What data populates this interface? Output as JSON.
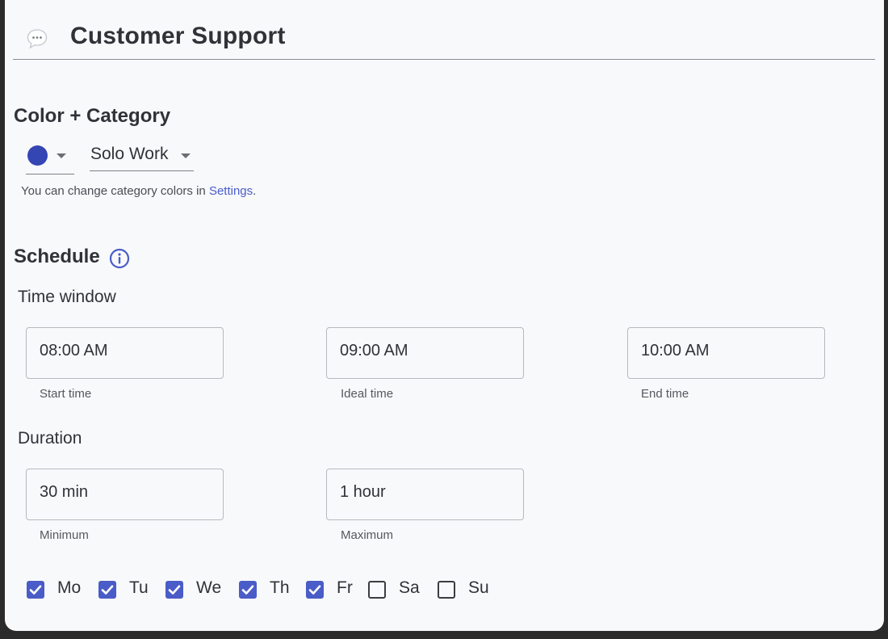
{
  "header": {
    "title": "Customer Support",
    "icon": "speech-bubble-icon"
  },
  "color_category": {
    "section_title": "Color + Category",
    "selected_color": "#3445b4",
    "category_value": "Solo Work",
    "hint_text": "You can change category colors in ",
    "hint_link": "Settings",
    "hint_end": "."
  },
  "schedule": {
    "section_title": "Schedule",
    "time_window": {
      "label": "Time window",
      "start": {
        "value": "08:00 AM",
        "helper": "Start time"
      },
      "ideal": {
        "value": "09:00 AM",
        "helper": "Ideal time"
      },
      "end": {
        "value": "10:00 AM",
        "helper": "End time"
      }
    },
    "duration": {
      "label": "Duration",
      "minimum": {
        "value": "30 min",
        "helper": "Minimum"
      },
      "maximum": {
        "value": "1 hour",
        "helper": "Maximum"
      }
    },
    "days": [
      {
        "label": "Mo",
        "checked": true
      },
      {
        "label": "Tu",
        "checked": true
      },
      {
        "label": "We",
        "checked": true
      },
      {
        "label": "Th",
        "checked": true
      },
      {
        "label": "Fr",
        "checked": true
      },
      {
        "label": "Sa",
        "checked": false
      },
      {
        "label": "Su",
        "checked": false
      }
    ]
  },
  "colors": {
    "accent": "#4a5cc7",
    "text": "#2f3337"
  }
}
